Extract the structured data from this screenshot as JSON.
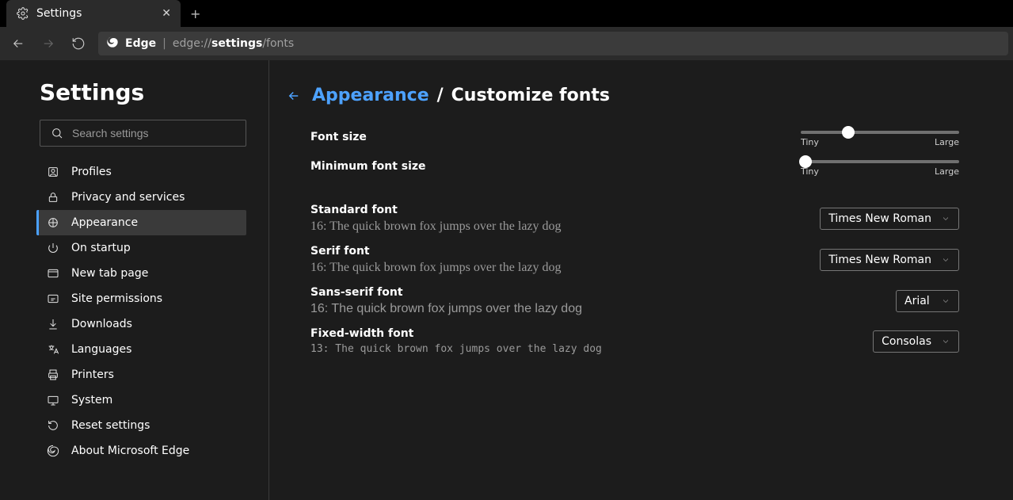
{
  "tab": {
    "title": "Settings"
  },
  "addr": {
    "prefix": "Edge",
    "p1": "edge://",
    "p2": "settings",
    "p3": "/fonts"
  },
  "sidebar": {
    "title": "Settings",
    "search_placeholder": "Search settings",
    "items": [
      {
        "label": "Profiles"
      },
      {
        "label": "Privacy and services"
      },
      {
        "label": "Appearance"
      },
      {
        "label": "On startup"
      },
      {
        "label": "New tab page"
      },
      {
        "label": "Site permissions"
      },
      {
        "label": "Downloads"
      },
      {
        "label": "Languages"
      },
      {
        "label": "Printers"
      },
      {
        "label": "System"
      },
      {
        "label": "Reset settings"
      },
      {
        "label": "About Microsoft Edge"
      }
    ]
  },
  "breadcrumb": {
    "parent": "Appearance",
    "sep": "/",
    "current": "Customize fonts"
  },
  "sliders": {
    "font_size_label": "Font size",
    "font_size_pct": 30,
    "min_font_size_label": "Minimum font size",
    "min_font_size_pct": 3,
    "tiny": "Tiny",
    "large": "Large"
  },
  "fonts": {
    "standard": {
      "label": "Standard font",
      "sample": "16: The quick brown fox jumps over the lazy dog",
      "value": "Times New Roman"
    },
    "serif": {
      "label": "Serif font",
      "sample": "16: The quick brown fox jumps over the lazy dog",
      "value": "Times New Roman"
    },
    "sans": {
      "label": "Sans-serif font",
      "sample": "16: The quick brown fox jumps over the lazy dog",
      "value": "Arial"
    },
    "mono": {
      "label": "Fixed-width font",
      "sample": "13: The quick brown fox jumps over the lazy dog",
      "value": "Consolas"
    }
  }
}
